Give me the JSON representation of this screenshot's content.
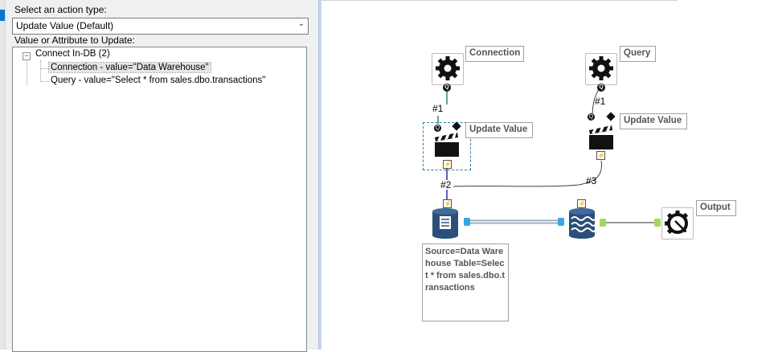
{
  "left_panel": {
    "action_type_label": "Select an action type:",
    "action_type_value": "Update Value (Default)",
    "value_attr_label": "Value or Attribute to Update:",
    "tree": {
      "root": "Connect In-DB (2)",
      "children": [
        "Connection - value=\"Data Warehouse\"",
        "Query - value=\"Select * from sales.dbo.transactions\""
      ]
    }
  },
  "canvas": {
    "annotations": {
      "connection": "Connection",
      "query": "Query",
      "update_value_1": "Update Value",
      "update_value_2": "Update Value",
      "output": "Output"
    },
    "connection_labels": [
      "#1",
      "#1",
      "#2",
      "#3"
    ],
    "source_annotation": "Source=Data Warehouse Table=Select * from sales.dbo.transactions",
    "colors": {
      "accent": "#0078d7",
      "anchor_blue": "#35a7e8",
      "anchor_green": "#a4d65e",
      "wire_green": "#2e8b57",
      "wire_blue": "#2b2b9a"
    }
  }
}
